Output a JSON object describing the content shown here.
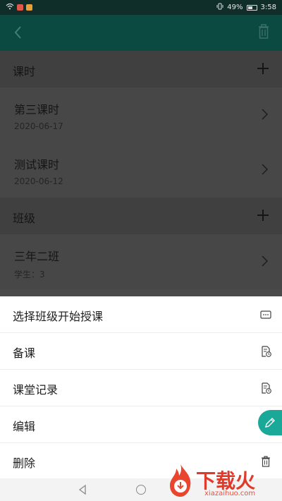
{
  "status_bar": {
    "battery": "49%",
    "time": "3:58"
  },
  "sections": {
    "lessons": {
      "title": "课时",
      "items": [
        {
          "title": "第三课时",
          "sub": "2020-06-17"
        },
        {
          "title": "测试课时",
          "sub": "2020-06-12"
        }
      ]
    },
    "classes": {
      "title": "班级",
      "items": [
        {
          "title": "三年二班",
          "sub": "学生：3"
        }
      ]
    }
  },
  "sheet": {
    "items": [
      {
        "label": "选择班级开始授课",
        "icon": "more-icon"
      },
      {
        "label": "备课",
        "icon": "document-clock-icon"
      },
      {
        "label": "课堂记录",
        "icon": "document-clock-icon"
      },
      {
        "label": "编辑",
        "icon": "edit-icon"
      },
      {
        "label": "删除",
        "icon": "trash-icon"
      }
    ]
  },
  "watermark": {
    "text": "下载火",
    "url": "xiazaihuo.com"
  },
  "colors": {
    "header": "#0b4a40",
    "accent": "#1aa898",
    "overlay": "#4a4a4a"
  }
}
